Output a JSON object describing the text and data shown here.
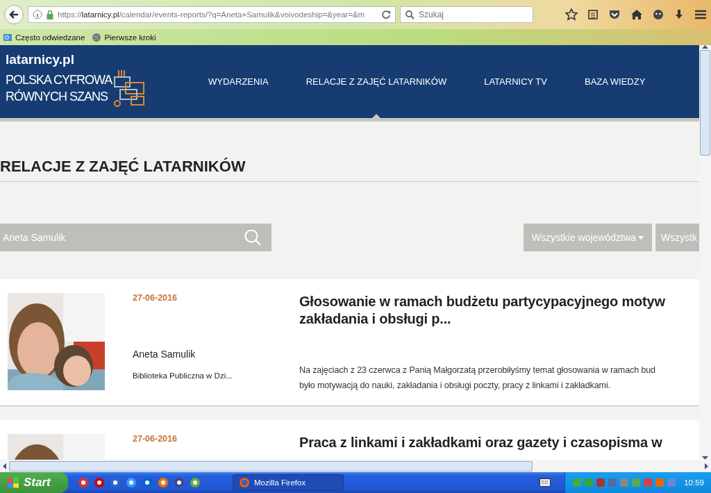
{
  "browser": {
    "url": {
      "scheme": "https://",
      "host": "latarnicy.pl",
      "path": "/calendar/events-reports/?q=Aneta+Samulik&voivodeship=&year=&m"
    },
    "search": {
      "placeholder": "Szukaj"
    },
    "bookmarks": [
      "Często odwiedzane",
      "Pierwsze kroki"
    ]
  },
  "site": {
    "domain": "latarnicy.pl",
    "logo_lines": [
      "POLSKA CYFROWA",
      "RÓWNYCH SZANS"
    ],
    "nav": [
      {
        "label": "WYDARZENIA",
        "selected": false
      },
      {
        "label": "RELACJE Z ZAJĘĆ LATARNIKÓW",
        "selected": true
      },
      {
        "label": "LATARNICY TV",
        "selected": false
      },
      {
        "label": "BAZA WIEDZY",
        "selected": false
      }
    ]
  },
  "page": {
    "heading": "RELACJE Z ZAJĘĆ LATARNIKÓW",
    "search": {
      "value": "Aneta Samulik"
    },
    "filters": [
      "Wszystkie województwa",
      "Wszystk"
    ],
    "events": [
      {
        "kind": "picture",
        "date": "27-06-2016",
        "author": "Aneta Samulik",
        "place": "Biblioteka Publiczna w Dzi...",
        "title": "Głosowanie w ramach budżetu partycypacyjnego motyw\nzakładania i obsługi p...",
        "description": [
          "Na zajęciach z 23 czerwca z Panią Małgorzatą przerobiłyśmy temat głosowania w ramach bud",
          "było motywacją do nauki, zakładania i obsługi poczty, pracy z linkami i zakładkami."
        ]
      },
      {
        "kind": "picture",
        "date": "27-06-2016",
        "title": "Praca z linkami i zakładkami oraz gazety i czasopisma w"
      }
    ]
  },
  "taskbar": {
    "start": "Start",
    "tasks": [
      {
        "label": "Mozilla Firefox",
        "selected": true
      }
    ],
    "clock": "10:59"
  }
}
